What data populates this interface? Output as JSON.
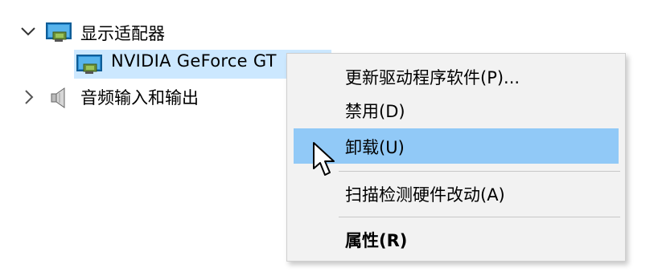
{
  "tree": {
    "display_adapters": {
      "label": "显示适配器",
      "icon": "monitor-icon",
      "expanded": true
    },
    "gpu": {
      "label": "NVIDIA GeForce GT",
      "icon": "monitor-icon",
      "selected": true
    },
    "audio": {
      "label": "音频输入和输出",
      "icon": "speaker-icon",
      "expanded": false
    }
  },
  "context_menu": {
    "items": [
      {
        "label": "更新驱动程序软件(P)...",
        "highlighted": false,
        "bold": false
      },
      {
        "label": "禁用(D)",
        "highlighted": false,
        "bold": false
      },
      {
        "label": "卸载(U)",
        "highlighted": true,
        "bold": false
      },
      {
        "label": "扫描检测硬件改动(A)",
        "highlighted": false,
        "bold": false
      },
      {
        "label": "属性(R)",
        "highlighted": false,
        "bold": true
      }
    ]
  },
  "colors": {
    "selection": "#cce8ff",
    "menu_highlight": "#91c9f7",
    "menu_background": "#f2f2f2"
  }
}
